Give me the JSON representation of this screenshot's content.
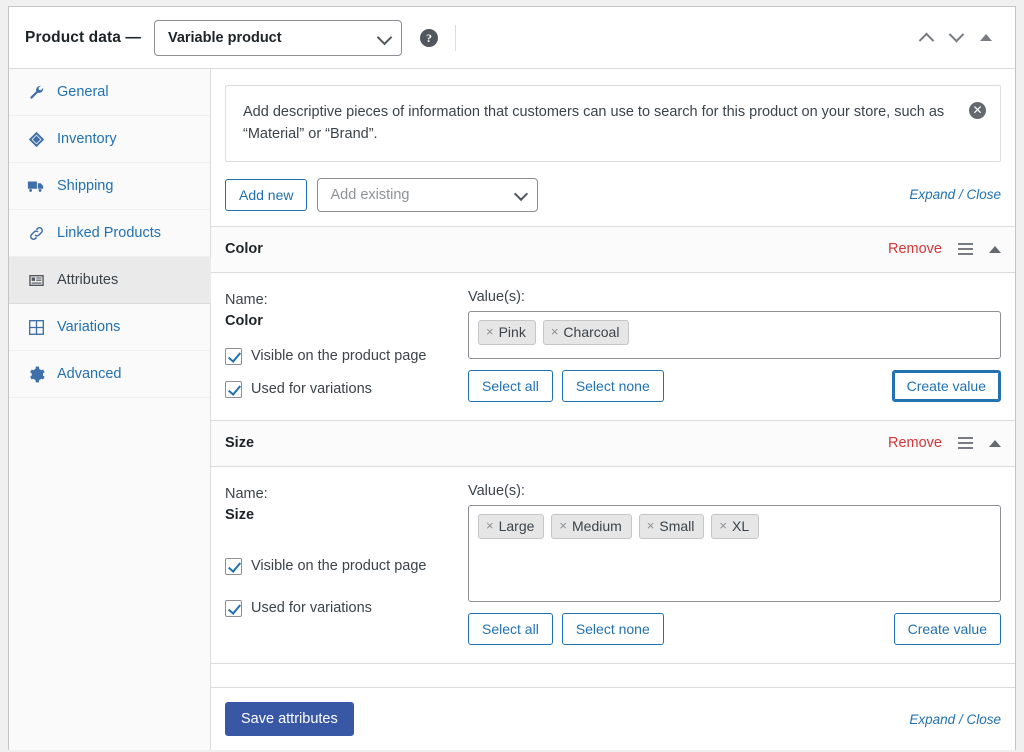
{
  "header": {
    "title": "Product data —",
    "product_type": "Variable product",
    "help_icon": "help-circle-icon",
    "move_up_icon": "chevron-up-icon",
    "move_down_icon": "chevron-down-icon",
    "toggle_icon": "triangle-up-icon"
  },
  "sidebar": {
    "items": [
      {
        "label": "General",
        "icon": "wrench-icon",
        "active": false
      },
      {
        "label": "Inventory",
        "icon": "tag-icon",
        "active": false
      },
      {
        "label": "Shipping",
        "icon": "truck-icon",
        "active": false
      },
      {
        "label": "Linked Products",
        "icon": "link-icon",
        "active": false
      },
      {
        "label": "Attributes",
        "icon": "list-panel-icon",
        "active": true
      },
      {
        "label": "Variations",
        "icon": "grid-icon",
        "active": false
      },
      {
        "label": "Advanced",
        "icon": "gear-icon",
        "active": false
      }
    ]
  },
  "notice": {
    "text": "Add descriptive pieces of information that customers can use to search for this product on your store, such as “Material” or “Brand”.",
    "close_icon": "close-circle-icon"
  },
  "toolbar": {
    "add_new_label": "Add new",
    "add_existing_placeholder": "Add existing",
    "expand_label": "Expand",
    "separator": "/",
    "close_label": "Close"
  },
  "attributes": [
    {
      "name": "Color",
      "remove_label": "Remove",
      "drag_icon": "drag-handle-icon",
      "collapse_icon": "triangle-up-icon",
      "name_label": "Name:",
      "values_label": "Value(s):",
      "visible_label": "Visible on the product page",
      "visible_checked": true,
      "variations_label": "Used for variations",
      "variations_checked": true,
      "values": [
        "Pink",
        "Charcoal"
      ],
      "select_all_label": "Select all",
      "select_none_label": "Select none",
      "create_value_label": "Create value",
      "create_value_focused": true
    },
    {
      "name": "Size",
      "remove_label": "Remove",
      "drag_icon": "drag-handle-icon",
      "collapse_icon": "triangle-up-icon",
      "name_label": "Name:",
      "values_label": "Value(s):",
      "visible_label": "Visible on the product page",
      "visible_checked": true,
      "variations_label": "Used for variations",
      "variations_checked": true,
      "values": [
        "Large",
        "Medium",
        "Small",
        "XL"
      ],
      "select_all_label": "Select all",
      "select_none_label": "Select none",
      "create_value_label": "Create value",
      "create_value_focused": false
    }
  ],
  "footer": {
    "save_label": "Save attributes",
    "expand_label": "Expand",
    "separator": "/",
    "close_label": "Close"
  },
  "colors": {
    "link": "#2271b1",
    "primary": "#3858a6",
    "danger": "#d63638"
  }
}
